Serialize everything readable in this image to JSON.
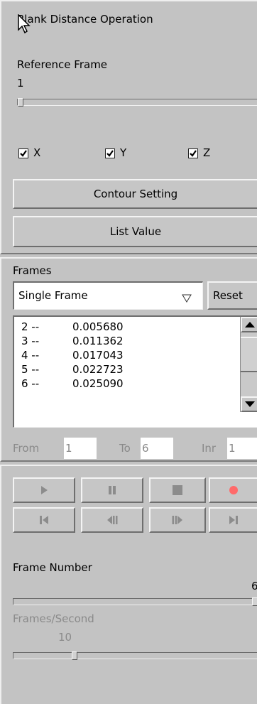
{
  "blank": {
    "title": "Blank Distance Operation",
    "ref_label": "Reference Frame",
    "ref_value": "1",
    "ref_level": 0,
    "checks": [
      {
        "label": "X",
        "checked": true
      },
      {
        "label": "Y",
        "checked": true
      },
      {
        "label": "Z",
        "checked": true
      }
    ],
    "contour_button": "Contour Setting",
    "list_button": "List Value"
  },
  "frames": {
    "title": "Frames",
    "mode": "Single Frame",
    "reset": "Reset",
    "rows": [
      {
        "idx": "2 --",
        "val": "0.005680"
      },
      {
        "idx": "3 --",
        "val": "0.011362"
      },
      {
        "idx": "4 --",
        "val": "0.017043"
      },
      {
        "idx": "5 --",
        "val": "0.022723"
      },
      {
        "idx": "6 --",
        "val": "0.025090"
      }
    ],
    "from_label": "From",
    "from_value": "1",
    "to_label": "To",
    "to_value": "6",
    "inr_label": "Inr",
    "inr_value": "1"
  },
  "player": {
    "frame_number_label": "Frame Number",
    "frame_number_value": "6",
    "frame_level": 1,
    "fps_label": "Frames/Second",
    "fps_value": "10",
    "record_color": "#ff6a6a"
  }
}
